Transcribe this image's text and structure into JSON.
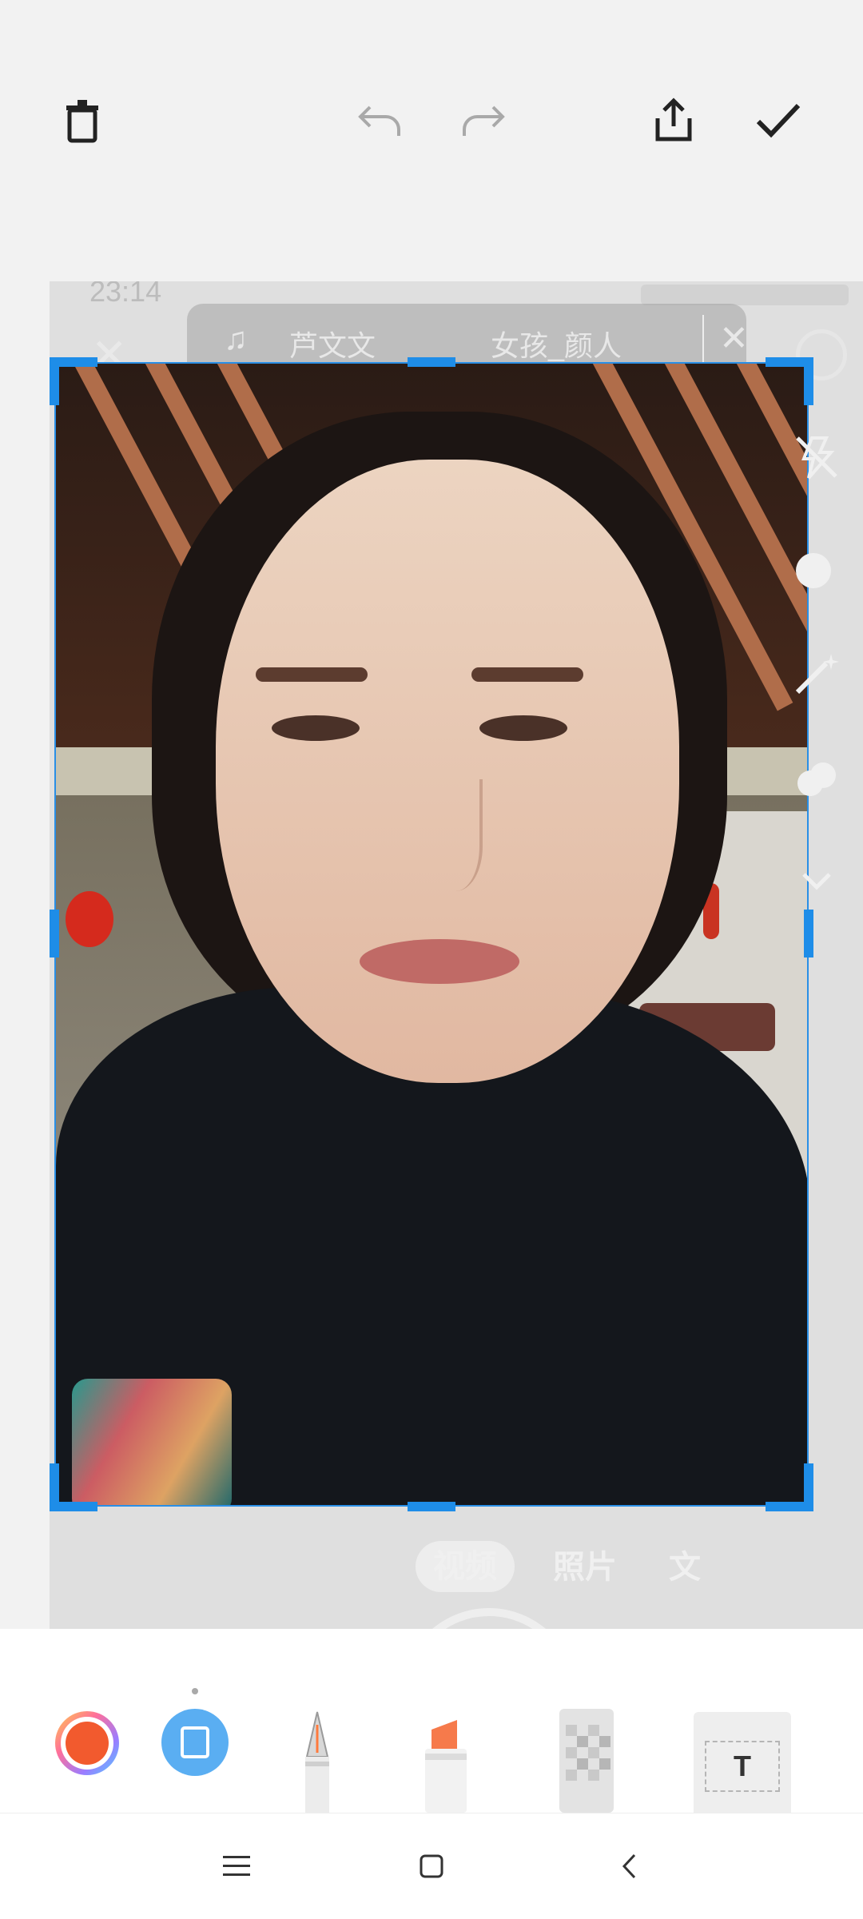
{
  "toolbar_top": {
    "delete": "delete",
    "undo": "undo",
    "redo": "redo",
    "share": "share",
    "confirm": "confirm"
  },
  "background": {
    "status_time": "23:14",
    "music": {
      "artist": "芦文文",
      "song": "女孩_颜人"
    },
    "mode_tabs": [
      {
        "label": "视频",
        "active": true
      },
      {
        "label": "照片",
        "active": false
      },
      {
        "label": "文",
        "active": false
      }
    ]
  },
  "bottom_tools": [
    {
      "name": "color-wheel"
    },
    {
      "name": "shape-square"
    },
    {
      "name": "fountain-pen"
    },
    {
      "name": "highlighter"
    },
    {
      "name": "mosaic"
    },
    {
      "name": "text-tool",
      "label": "T"
    }
  ],
  "navbar": [
    "menu",
    "home",
    "back"
  ],
  "colors": {
    "accent": "#1e8de8",
    "toolbar_bg": "#ffffff",
    "page_bg": "#f2f2f2"
  }
}
